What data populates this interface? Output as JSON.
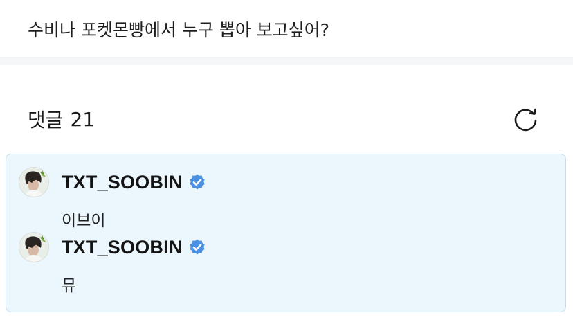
{
  "post": {
    "question": "수비나 포켓몬빵에서 누구 뽑아 보고싶어?"
  },
  "comments_section": {
    "label": "댓글",
    "count": "21",
    "refresh_icon": "refresh-icon"
  },
  "comments": [
    {
      "username": "TXT_SOOBIN",
      "verified": true,
      "text": "이브이"
    },
    {
      "username": "TXT_SOOBIN",
      "verified": true,
      "text": "뮤"
    }
  ],
  "colors": {
    "verified_badge": "#4a90e2",
    "comment_box_bg": "#ebf6fd",
    "comment_box_border": "#c9dcea",
    "divider": "#f4f5f7"
  }
}
